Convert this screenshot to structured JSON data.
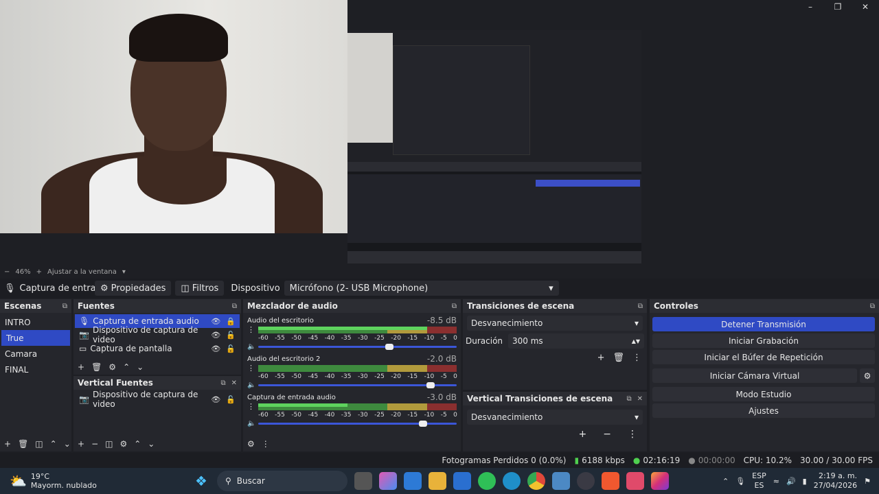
{
  "preview": {
    "zoom_minus": "−",
    "zoom_level": "46%",
    "zoom_plus": "+",
    "fit_label": "Ajustar a la ventana"
  },
  "source_toolbar": {
    "source_name": "Captura de entrada a",
    "properties_label": "Propiedades",
    "filters_label": "Filtros",
    "device_label": "Dispositivo",
    "device_value": "Micrófono (2- USB Microphone)"
  },
  "scenes": {
    "title": "Escenas",
    "items": [
      "INTRO",
      "True",
      "Camara",
      "FINAL"
    ],
    "active_index": 1
  },
  "sources": {
    "title": "Fuentes",
    "items": [
      "Captura de entrada audio",
      "Dispositivo de captura de video",
      "Captura de pantalla"
    ]
  },
  "vertical_sources": {
    "title": "Vertical Fuentes",
    "items": [
      "Dispositivo de captura de video"
    ]
  },
  "mixer": {
    "title": "Mezclador de audio",
    "ticks": [
      "-60",
      "-55",
      "-50",
      "-45",
      "-40",
      "-35",
      "-30",
      "-25",
      "-20",
      "-15",
      "-10",
      "-5",
      "0"
    ],
    "channels": [
      {
        "name": "Audio del escritorio",
        "db": "-8.5 dB",
        "level": 0.85,
        "volume": 0.66
      },
      {
        "name": "Audio del escritorio 2",
        "db": "-2.0 dB",
        "level": 0.0,
        "volume": 0.87
      },
      {
        "name": "Captura de entrada audio",
        "db": "-3.0 dB",
        "level": 0.45,
        "volume": 0.83
      }
    ]
  },
  "transitions": {
    "title": "Transiciones de escena",
    "type": "Desvanecimiento",
    "duration_label": "Duración",
    "duration_value": "300 ms"
  },
  "vertical_transitions": {
    "title": "Vertical Transiciones de escena",
    "type": "Desvanecimiento"
  },
  "controls": {
    "title": "Controles",
    "stop_stream": "Detener Transmisión",
    "start_recording": "Iniciar Grabación",
    "start_replay": "Iniciar el Búfer de Repetición",
    "start_vcam": "Iniciar Cámara Virtual",
    "studio_mode": "Modo Estudio",
    "settings": "Ajustes"
  },
  "status": {
    "dropped_frames": "Fotogramas Perdidos 0 (0.0%)",
    "bitrate": "6188 kbps",
    "stream_time": "02:16:19",
    "record_time": "00:00:00",
    "cpu": "CPU: 10.2%",
    "fps": "30.00 / 30.00 FPS"
  },
  "taskbar": {
    "temp": "19°C",
    "weather": "Mayorm. nublado",
    "search": "Buscar",
    "lang_top": "ESP",
    "lang_bottom": "ES",
    "time": "2:19 a. m.",
    "date": "27/04/2026"
  },
  "colors": {
    "accent": "#2f4ac4",
    "background": "#1e1f24",
    "panel": "#25262c"
  }
}
